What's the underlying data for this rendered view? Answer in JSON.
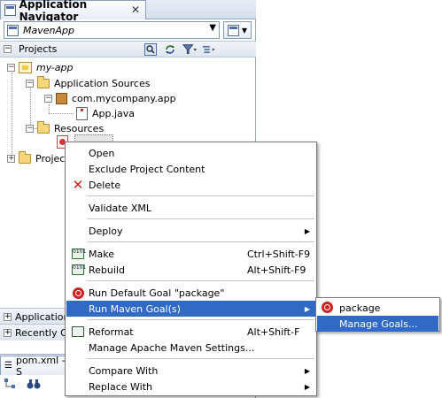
{
  "navigator": {
    "tab_title": "Application Navigator",
    "close_glyph": "✕",
    "project_combo_value": "MavenApp",
    "projects_header_label": "Projects",
    "tree": {
      "app_node": "my-app",
      "app_sources": "Application Sources",
      "package": "com.mycompany.app",
      "java_file": "App.java",
      "resources": "Resources",
      "projects_truncated": "Projec"
    },
    "accordions": {
      "application": "Application",
      "recently": "Recently O"
    },
    "structure_tab_label": "pom.xml - S"
  },
  "context_menu": {
    "items": [
      {
        "label": "Open",
        "shortcut": ""
      },
      {
        "label": "Exclude Project Content",
        "shortcut": ""
      },
      {
        "label": "Delete",
        "shortcut": "",
        "icon": "delete-icon"
      },
      {
        "label": "Validate XML",
        "shortcut": ""
      },
      {
        "label": "Deploy",
        "shortcut": "",
        "submenu": true
      },
      {
        "label": "Make",
        "shortcut": "Ctrl+Shift-F9",
        "icon": "make-icon"
      },
      {
        "label": "Rebuild",
        "shortcut": "Alt+Shift-F9",
        "icon": "rebuild-icon"
      },
      {
        "label": "Run Default Goal \"package\"",
        "shortcut": "",
        "icon": "maven-goal-icon"
      },
      {
        "label": "Run Maven Goal(s)",
        "shortcut": "",
        "submenu": true,
        "highlighted": true
      },
      {
        "label": "Reformat",
        "shortcut": "Alt+Shift-F",
        "icon": "reformat-icon"
      },
      {
        "label": "Manage Apache Maven Settings...",
        "shortcut": ""
      },
      {
        "label": "Compare With",
        "shortcut": "",
        "submenu": true
      },
      {
        "label": "Replace With",
        "shortcut": "",
        "submenu": true
      }
    ]
  },
  "submenu": {
    "items": [
      {
        "label": "package",
        "icon": "maven-goal-icon"
      },
      {
        "label": "Manage Goals...",
        "highlighted": true
      }
    ]
  },
  "colors": {
    "selection": "#316ac5",
    "panel_border": "#9aa9c2"
  }
}
